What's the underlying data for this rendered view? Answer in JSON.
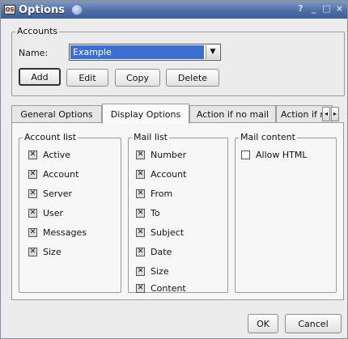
{
  "window": {
    "title": "Options",
    "app_icon_text": "OS"
  },
  "titlebar_buttons": [
    "?",
    "_",
    "□",
    "×"
  ],
  "accounts": {
    "legend": "Accounts",
    "name_label": "Name:",
    "name_value": "Example",
    "dropdown_arrow": "▼",
    "buttons": {
      "add": "Add",
      "edit": "Edit",
      "copy": "Copy",
      "delete": "Delete"
    }
  },
  "tabs": [
    {
      "label": "General Options",
      "active": false
    },
    {
      "label": "Display Options",
      "active": true
    },
    {
      "label": "Action if no mail",
      "active": false
    },
    {
      "label": "Action if r",
      "active": false
    }
  ],
  "tab_scroll": {
    "left": "◂",
    "right": "▸"
  },
  "display_options": {
    "account_list": {
      "legend": "Account list",
      "items": [
        {
          "label": "Active",
          "checked": true
        },
        {
          "label": "Account",
          "checked": true
        },
        {
          "label": "Server",
          "checked": true
        },
        {
          "label": "User",
          "checked": true
        },
        {
          "label": "Messages",
          "checked": true
        },
        {
          "label": "Size",
          "checked": true
        }
      ]
    },
    "mail_list": {
      "legend": "Mail list",
      "items": [
        {
          "label": "Number",
          "checked": true
        },
        {
          "label": "Account",
          "checked": true
        },
        {
          "label": "From",
          "checked": true
        },
        {
          "label": "To",
          "checked": true
        },
        {
          "label": "Subject",
          "checked": true
        },
        {
          "label": "Date",
          "checked": true
        },
        {
          "label": "Size",
          "checked": true
        },
        {
          "label": "Content",
          "checked": true
        }
      ]
    },
    "mail_content": {
      "legend": "Mail content",
      "items": [
        {
          "label": "Allow HTML",
          "checked": false
        }
      ]
    }
  },
  "check_mark": "✕",
  "footer": {
    "ok": "OK",
    "cancel": "Cancel"
  }
}
